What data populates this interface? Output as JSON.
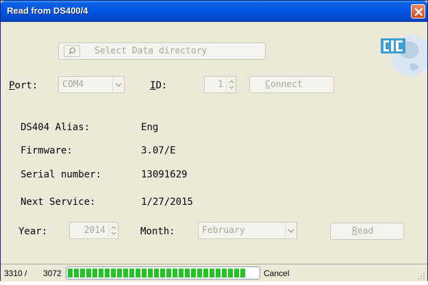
{
  "window": {
    "title": "Read from DS400/4"
  },
  "toolbar": {
    "select_dir_label": "Select Data directory"
  },
  "connection": {
    "port_label": "Port:",
    "port_value": "COM4",
    "id_label": "ID:",
    "id_value": "1",
    "connect_label": "Connect"
  },
  "info": {
    "alias_label": "DS404 Alias:",
    "alias_value": "Eng",
    "firmware_label": "Firmware:",
    "firmware_value": "3.07/E",
    "serial_label": "Serial number:",
    "serial_value": "13091629",
    "service_label": "Next Service:",
    "service_value": "1/27/2015"
  },
  "period": {
    "year_label": "Year:",
    "year_value": "2014",
    "month_label": "Month:",
    "month_value": "February",
    "read_label": "Read"
  },
  "status": {
    "total": "3310 /",
    "current": "3072",
    "progress_fraction": 0.93,
    "cancel_label": "Cancel"
  },
  "colors": {
    "progress": "#22c322",
    "title_bar": "#0055e5",
    "close": "#d34b1d"
  }
}
